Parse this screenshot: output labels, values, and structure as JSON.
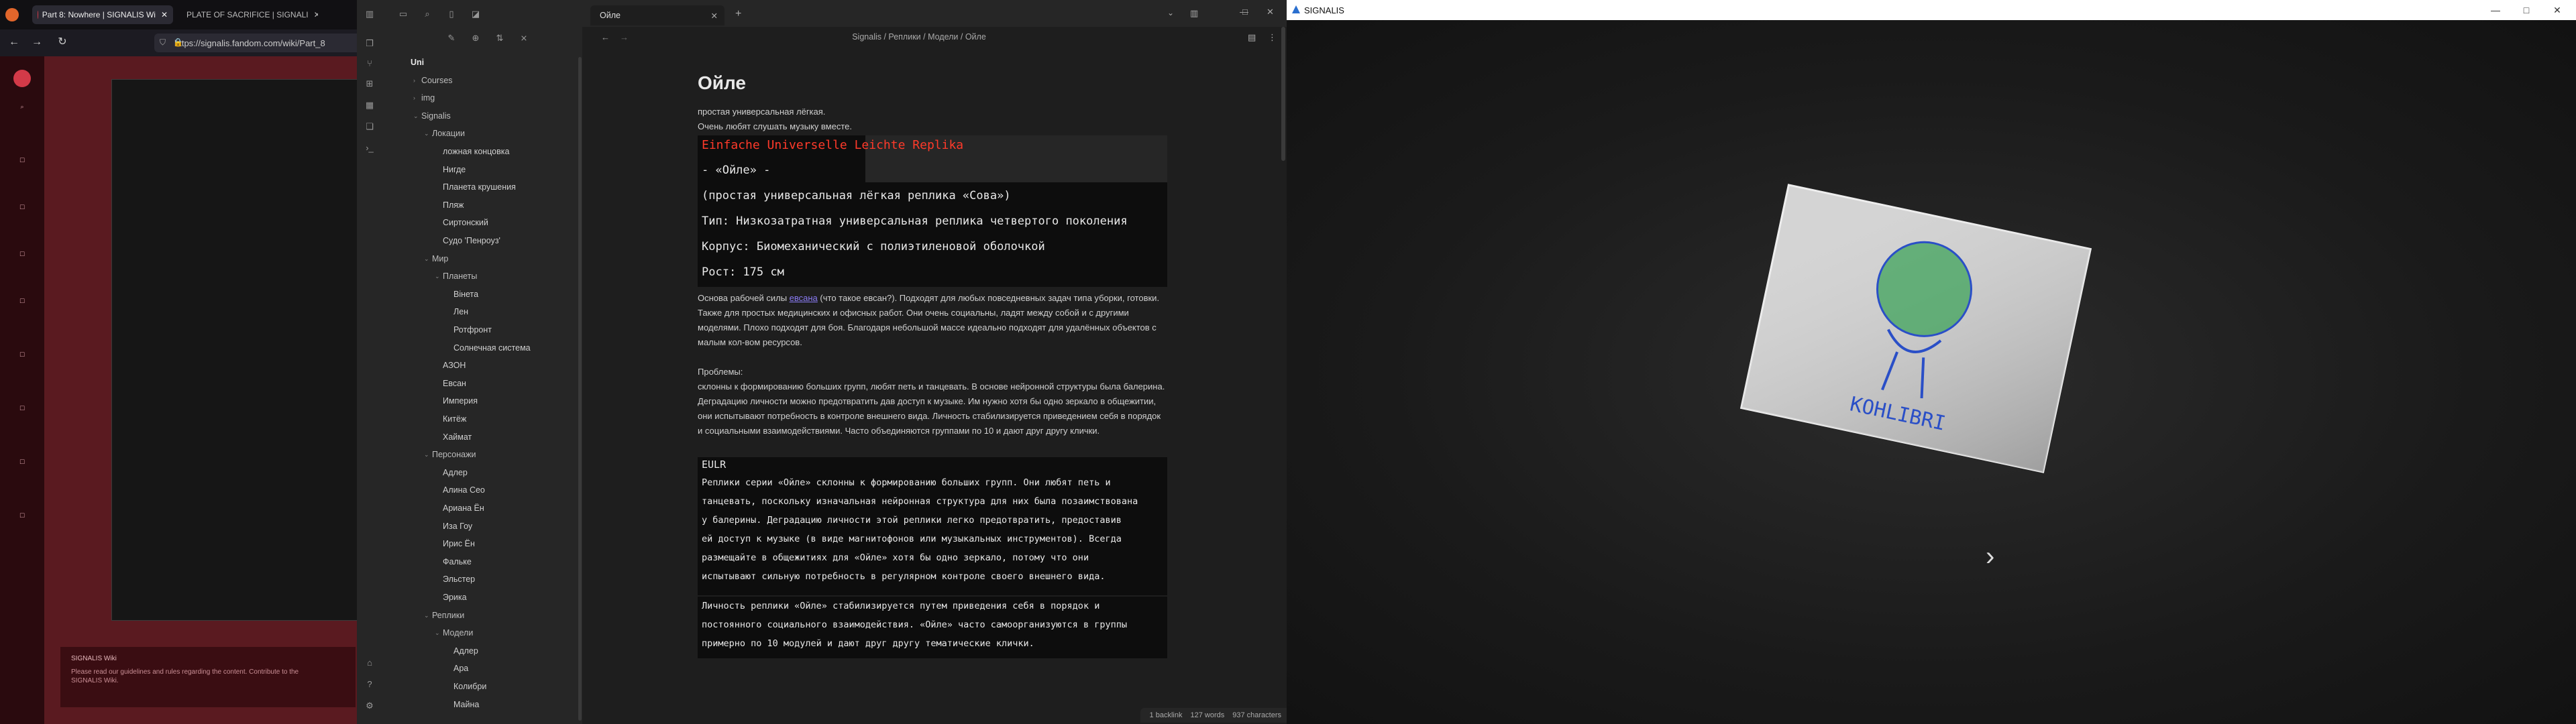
{
  "browser": {
    "tabs": [
      {
        "label": "Part 8: Nowhere | SIGNALIS Wi",
        "active": true
      },
      {
        "label": "PLATE OF SACRIFICE | SIGNALI",
        "active": false
      }
    ],
    "url": "https://signalis.fandom.com/wiki/Part_8",
    "sidebar_items": [
      "",
      "",
      "",
      "",
      "",
      "",
      "",
      "",
      ""
    ],
    "banner": {
      "title": "SIGNALIS Wiki",
      "text": "Please read our guidelines and rules regarding the content. Contribute to the SIGNALIS Wiki."
    },
    "colors": {
      "brand": "#5a1a20",
      "sidebar": "#2a0a0e"
    }
  },
  "obsidian": {
    "vault": "Uni",
    "tree": [
      {
        "label": "Uni",
        "level": 0,
        "type": "vault"
      },
      {
        "label": "Courses",
        "level": 1,
        "type": "folder",
        "collapsed": true
      },
      {
        "label": "img",
        "level": 1,
        "type": "folder",
        "collapsed": true
      },
      {
        "label": "Signalis",
        "level": 1,
        "type": "folder",
        "collapsed": false
      },
      {
        "label": "Локации",
        "level": 2,
        "type": "folder",
        "collapsed": false
      },
      {
        "label": "ложная концовка",
        "level": 3,
        "type": "file"
      },
      {
        "label": "Нигде",
        "level": 3,
        "type": "file"
      },
      {
        "label": "Планета крушения",
        "level": 3,
        "type": "file"
      },
      {
        "label": "Пляж",
        "level": 3,
        "type": "file"
      },
      {
        "label": "Сиртонский",
        "level": 3,
        "type": "file"
      },
      {
        "label": "Судо 'Пенроуз'",
        "level": 3,
        "type": "file"
      },
      {
        "label": "Мир",
        "level": 2,
        "type": "folder",
        "collapsed": false
      },
      {
        "label": "Планеты",
        "level": 3,
        "type": "folder",
        "collapsed": false
      },
      {
        "label": "Вінета",
        "level": 4,
        "type": "file"
      },
      {
        "label": "Лен",
        "level": 4,
        "type": "file"
      },
      {
        "label": "Ротфронт",
        "level": 4,
        "type": "file"
      },
      {
        "label": "Солнечная система",
        "level": 4,
        "type": "file"
      },
      {
        "label": "АЗОН",
        "level": 3,
        "type": "file"
      },
      {
        "label": "Евсан",
        "level": 3,
        "type": "file"
      },
      {
        "label": "Империя",
        "level": 3,
        "type": "file"
      },
      {
        "label": "Китёж",
        "level": 3,
        "type": "file"
      },
      {
        "label": "Хаймат",
        "level": 3,
        "type": "file"
      },
      {
        "label": "Персонажи",
        "level": 2,
        "type": "folder",
        "collapsed": false
      },
      {
        "label": "Адлер",
        "level": 3,
        "type": "file"
      },
      {
        "label": "Алина Сео",
        "level": 3,
        "type": "file"
      },
      {
        "label": "Ариана Ён",
        "level": 3,
        "type": "file"
      },
      {
        "label": "Иза Гоу",
        "level": 3,
        "type": "file"
      },
      {
        "label": "Ирис Ён",
        "level": 3,
        "type": "file"
      },
      {
        "label": "Фальке",
        "level": 3,
        "type": "file"
      },
      {
        "label": "Эльстер",
        "level": 3,
        "type": "file"
      },
      {
        "label": "Эрика",
        "level": 3,
        "type": "file"
      },
      {
        "label": "Реплики",
        "level": 2,
        "type": "folder",
        "collapsed": false
      },
      {
        "label": "Модели",
        "level": 3,
        "type": "folder",
        "collapsed": false
      },
      {
        "label": "Адлер",
        "level": 4,
        "type": "file"
      },
      {
        "label": "Ара",
        "level": 4,
        "type": "file"
      },
      {
        "label": "Колибри",
        "level": 4,
        "type": "file"
      },
      {
        "label": "Майна",
        "level": 4,
        "type": "file"
      }
    ],
    "tab_title": "Ойле",
    "breadcrumb": "Signalis  /  Реплики  /  Модели  /  Ойле",
    "note": {
      "title": "Ойле",
      "intro_lines": [
        "простая универсальная лёгкая.",
        "Очень любят слушать музыку вместе."
      ],
      "wiki_image1": [
        "Einfache Universelle Leichte Replika",
        "- «Ойле» -",
        "(простая универсальная лёгкая реплика «Сова»)",
        "Тип: Низкозатратная универсальная реплика четвертого поколения",
        "Корпус: Биомеханический с полиэтиленовой оболочкой",
        "Рост: 175 см"
      ],
      "para1_pre": "Основа рабочей силы ",
      "para1_link": "евсана",
      "para1_post": " (что такое евсан?). Подходят для любых повседневных задач типа уборки, готовки. Также для простых медицинских и офисных работ. Они очень социальны, ладят между собой и с другими моделями. Плохо подходят для боя. Благодаря небольшой массе идеально подходят для удалённых объектов с малым кол-вом ресурсов.",
      "problems_label": "Проблемы:",
      "problems_text": "склонны к формированию больших групп, любят петь и танцевать. В основе нейронной структуры была балерина. Деградацию личности можно предотвратить дав доступ к музыке. Им нужно хотя бы одно зеркало в общежитии, они испытывают потребность в контроле внешнего вида. Личность стабилизируется приведением себя в порядок и социальными взаимодействиями. Часто объединяются группами по 10 и дают друг другу клички.",
      "wiki_image2_title": "EULR",
      "wiki_image2_lines": [
        "Реплики серии «Ойле» склонны к формированию больших групп. Они любят петь и",
        "танцевать, поскольку изначальная нейронная структура для них была позаимствована",
        "у балерины. Деградацию личности этой реплики легко предотвратить, предоставив",
        "ей доступ к музыке (в виде магнитофонов или музыкальных инструментов). Всегда",
        "размещайте в общежитиях для «Ойле» хотя бы одно зеркало, потому что они",
        "испытывают сильную потребность в регулярном контроле своего внешнего вида."
      ],
      "wiki_image3_lines": [
        "Личность реплики «Ойле» стабилизируется путем приведения себя в порядок и",
        "постоянного социального взаимодействия. «Ойле» часто самоорганизуются в группы",
        "примерно по 10 модулей и дают друг другу тематические клички."
      ]
    },
    "status": {
      "backlinks": "1 backlink",
      "words": "127 words",
      "chars": "937 characters"
    }
  },
  "game": {
    "window_title": "SIGNALIS",
    "item_text": "KOHLIBRI",
    "colors": {
      "card": "#d9d9d9",
      "ink": "#2a4fc7",
      "globe": "#3fa35b"
    }
  }
}
